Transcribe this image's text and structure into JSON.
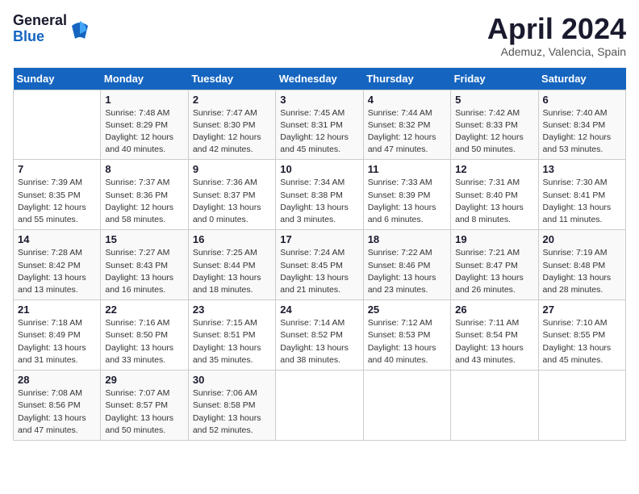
{
  "header": {
    "logo_general": "General",
    "logo_blue": "Blue",
    "month_title": "April 2024",
    "location": "Ademuz, Valencia, Spain"
  },
  "days_of_week": [
    "Sunday",
    "Monday",
    "Tuesday",
    "Wednesday",
    "Thursday",
    "Friday",
    "Saturday"
  ],
  "weeks": [
    [
      {
        "day": "",
        "sunrise": "",
        "sunset": "",
        "daylight": ""
      },
      {
        "day": "1",
        "sunrise": "Sunrise: 7:48 AM",
        "sunset": "Sunset: 8:29 PM",
        "daylight": "Daylight: 12 hours and 40 minutes."
      },
      {
        "day": "2",
        "sunrise": "Sunrise: 7:47 AM",
        "sunset": "Sunset: 8:30 PM",
        "daylight": "Daylight: 12 hours and 42 minutes."
      },
      {
        "day": "3",
        "sunrise": "Sunrise: 7:45 AM",
        "sunset": "Sunset: 8:31 PM",
        "daylight": "Daylight: 12 hours and 45 minutes."
      },
      {
        "day": "4",
        "sunrise": "Sunrise: 7:44 AM",
        "sunset": "Sunset: 8:32 PM",
        "daylight": "Daylight: 12 hours and 47 minutes."
      },
      {
        "day": "5",
        "sunrise": "Sunrise: 7:42 AM",
        "sunset": "Sunset: 8:33 PM",
        "daylight": "Daylight: 12 hours and 50 minutes."
      },
      {
        "day": "6",
        "sunrise": "Sunrise: 7:40 AM",
        "sunset": "Sunset: 8:34 PM",
        "daylight": "Daylight: 12 hours and 53 minutes."
      }
    ],
    [
      {
        "day": "7",
        "sunrise": "Sunrise: 7:39 AM",
        "sunset": "Sunset: 8:35 PM",
        "daylight": "Daylight: 12 hours and 55 minutes."
      },
      {
        "day": "8",
        "sunrise": "Sunrise: 7:37 AM",
        "sunset": "Sunset: 8:36 PM",
        "daylight": "Daylight: 12 hours and 58 minutes."
      },
      {
        "day": "9",
        "sunrise": "Sunrise: 7:36 AM",
        "sunset": "Sunset: 8:37 PM",
        "daylight": "Daylight: 13 hours and 0 minutes."
      },
      {
        "day": "10",
        "sunrise": "Sunrise: 7:34 AM",
        "sunset": "Sunset: 8:38 PM",
        "daylight": "Daylight: 13 hours and 3 minutes."
      },
      {
        "day": "11",
        "sunrise": "Sunrise: 7:33 AM",
        "sunset": "Sunset: 8:39 PM",
        "daylight": "Daylight: 13 hours and 6 minutes."
      },
      {
        "day": "12",
        "sunrise": "Sunrise: 7:31 AM",
        "sunset": "Sunset: 8:40 PM",
        "daylight": "Daylight: 13 hours and 8 minutes."
      },
      {
        "day": "13",
        "sunrise": "Sunrise: 7:30 AM",
        "sunset": "Sunset: 8:41 PM",
        "daylight": "Daylight: 13 hours and 11 minutes."
      }
    ],
    [
      {
        "day": "14",
        "sunrise": "Sunrise: 7:28 AM",
        "sunset": "Sunset: 8:42 PM",
        "daylight": "Daylight: 13 hours and 13 minutes."
      },
      {
        "day": "15",
        "sunrise": "Sunrise: 7:27 AM",
        "sunset": "Sunset: 8:43 PM",
        "daylight": "Daylight: 13 hours and 16 minutes."
      },
      {
        "day": "16",
        "sunrise": "Sunrise: 7:25 AM",
        "sunset": "Sunset: 8:44 PM",
        "daylight": "Daylight: 13 hours and 18 minutes."
      },
      {
        "day": "17",
        "sunrise": "Sunrise: 7:24 AM",
        "sunset": "Sunset: 8:45 PM",
        "daylight": "Daylight: 13 hours and 21 minutes."
      },
      {
        "day": "18",
        "sunrise": "Sunrise: 7:22 AM",
        "sunset": "Sunset: 8:46 PM",
        "daylight": "Daylight: 13 hours and 23 minutes."
      },
      {
        "day": "19",
        "sunrise": "Sunrise: 7:21 AM",
        "sunset": "Sunset: 8:47 PM",
        "daylight": "Daylight: 13 hours and 26 minutes."
      },
      {
        "day": "20",
        "sunrise": "Sunrise: 7:19 AM",
        "sunset": "Sunset: 8:48 PM",
        "daylight": "Daylight: 13 hours and 28 minutes."
      }
    ],
    [
      {
        "day": "21",
        "sunrise": "Sunrise: 7:18 AM",
        "sunset": "Sunset: 8:49 PM",
        "daylight": "Daylight: 13 hours and 31 minutes."
      },
      {
        "day": "22",
        "sunrise": "Sunrise: 7:16 AM",
        "sunset": "Sunset: 8:50 PM",
        "daylight": "Daylight: 13 hours and 33 minutes."
      },
      {
        "day": "23",
        "sunrise": "Sunrise: 7:15 AM",
        "sunset": "Sunset: 8:51 PM",
        "daylight": "Daylight: 13 hours and 35 minutes."
      },
      {
        "day": "24",
        "sunrise": "Sunrise: 7:14 AM",
        "sunset": "Sunset: 8:52 PM",
        "daylight": "Daylight: 13 hours and 38 minutes."
      },
      {
        "day": "25",
        "sunrise": "Sunrise: 7:12 AM",
        "sunset": "Sunset: 8:53 PM",
        "daylight": "Daylight: 13 hours and 40 minutes."
      },
      {
        "day": "26",
        "sunrise": "Sunrise: 7:11 AM",
        "sunset": "Sunset: 8:54 PM",
        "daylight": "Daylight: 13 hours and 43 minutes."
      },
      {
        "day": "27",
        "sunrise": "Sunrise: 7:10 AM",
        "sunset": "Sunset: 8:55 PM",
        "daylight": "Daylight: 13 hours and 45 minutes."
      }
    ],
    [
      {
        "day": "28",
        "sunrise": "Sunrise: 7:08 AM",
        "sunset": "Sunset: 8:56 PM",
        "daylight": "Daylight: 13 hours and 47 minutes."
      },
      {
        "day": "29",
        "sunrise": "Sunrise: 7:07 AM",
        "sunset": "Sunset: 8:57 PM",
        "daylight": "Daylight: 13 hours and 50 minutes."
      },
      {
        "day": "30",
        "sunrise": "Sunrise: 7:06 AM",
        "sunset": "Sunset: 8:58 PM",
        "daylight": "Daylight: 13 hours and 52 minutes."
      },
      {
        "day": "",
        "sunrise": "",
        "sunset": "",
        "daylight": ""
      },
      {
        "day": "",
        "sunrise": "",
        "sunset": "",
        "daylight": ""
      },
      {
        "day": "",
        "sunrise": "",
        "sunset": "",
        "daylight": ""
      },
      {
        "day": "",
        "sunrise": "",
        "sunset": "",
        "daylight": ""
      }
    ]
  ]
}
